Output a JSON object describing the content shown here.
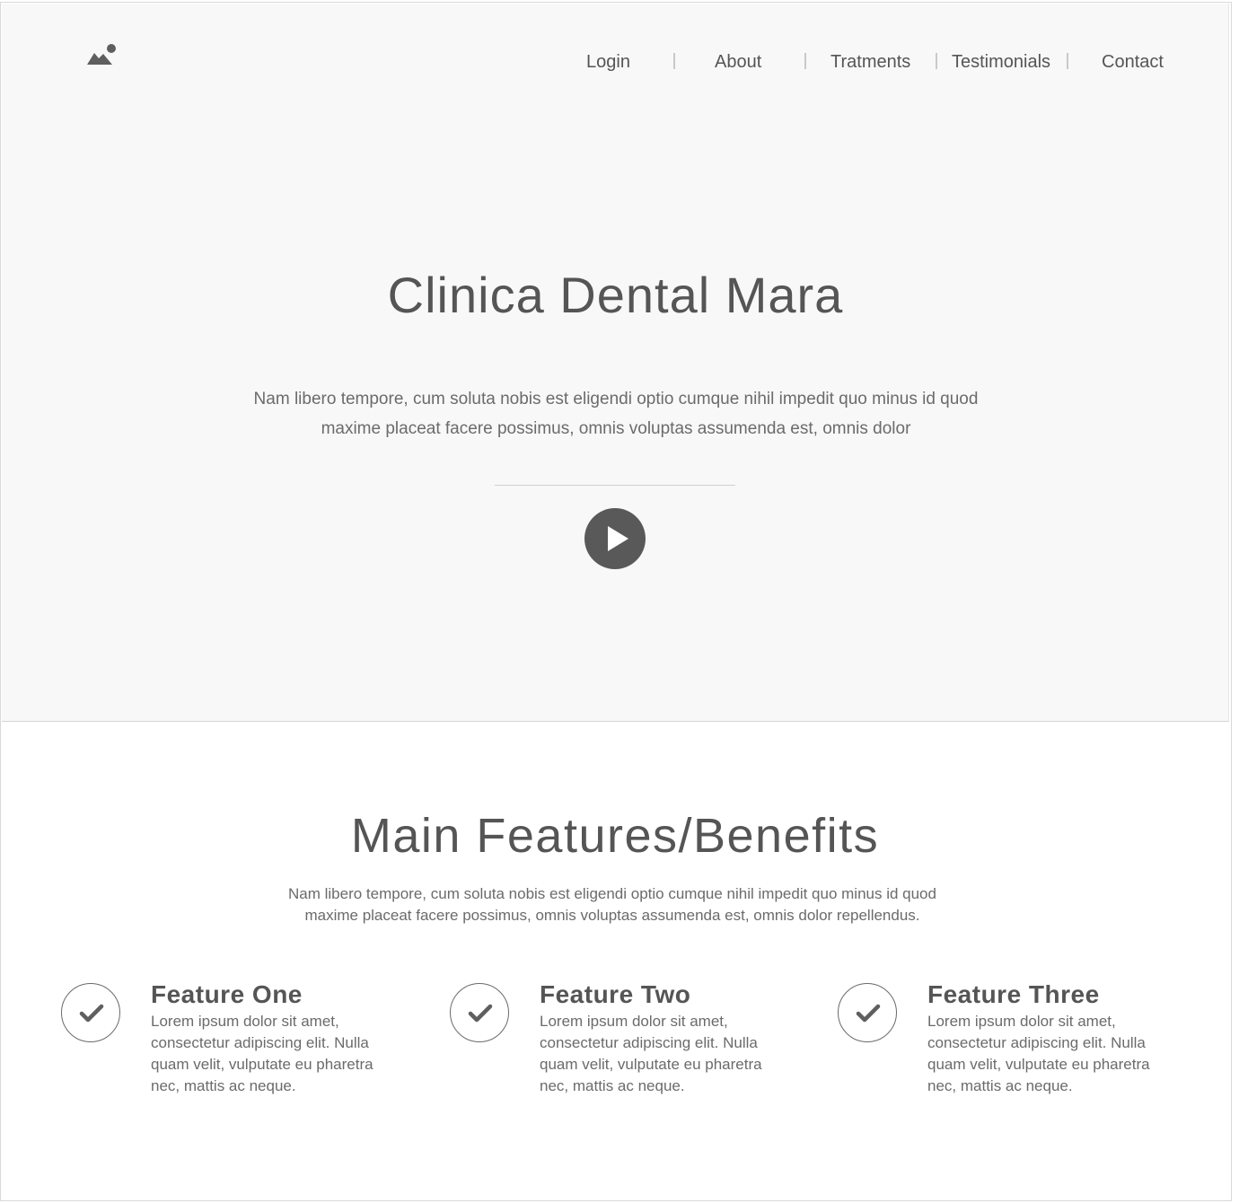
{
  "header": {
    "logo_icon": "landscape-image-icon",
    "nav": [
      {
        "label": "Login"
      },
      {
        "label": "About"
      },
      {
        "label": "Tratments"
      },
      {
        "label": "Testimonials"
      },
      {
        "label": "Contact"
      }
    ]
  },
  "hero": {
    "title": "Clinica Dental Mara",
    "text": "Nam libero tempore, cum soluta nobis est eligendi optio cumque nihil impedit quo minus id quod maxime placeat facere possimus, omnis voluptas assumenda est, omnis dolor",
    "play_icon": "play-icon"
  },
  "features": {
    "title": "Main Features/Benefits",
    "text": "Nam libero tempore, cum soluta nobis est eligendi optio cumque nihil impedit quo minus id quod maxime placeat facere possimus, omnis voluptas assumenda est, omnis dolor repellendus.",
    "items": [
      {
        "title": "Feature One",
        "text": "Lorem ipsum dolor sit amet, consectetur adipiscing elit. Nulla quam velit, vulputate eu pharetra nec, mattis ac neque.",
        "icon": "check-circle-icon"
      },
      {
        "title": "Feature Two",
        "text": "Lorem ipsum dolor sit amet, consectetur adipiscing elit. Nulla quam velit, vulputate eu pharetra nec, mattis ac neque.",
        "icon": "check-circle-icon"
      },
      {
        "title": "Feature Three",
        "text": "Lorem ipsum dolor sit amet, consectetur adipiscing elit. Nulla quam velit, vulputate eu pharetra nec, mattis ac neque.",
        "icon": "check-circle-icon"
      }
    ]
  },
  "colors": {
    "hero_background": "#f8f8f8",
    "text": "#555555",
    "icon": "#595959"
  }
}
